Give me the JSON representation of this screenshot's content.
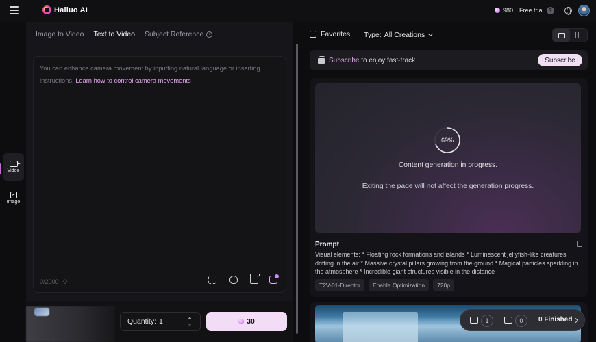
{
  "app": {
    "name": "Hailuo AI"
  },
  "header": {
    "credits": "980",
    "free_trial": "Free trial",
    "help_glyph": "?"
  },
  "rail": {
    "items": [
      {
        "label": "Video",
        "icon": "video-icon",
        "active": true
      },
      {
        "label": "Image",
        "icon": "image-icon",
        "active": false
      }
    ]
  },
  "left": {
    "tabs": [
      {
        "label": "Image to Video",
        "active": false
      },
      {
        "label": "Text to Video",
        "active": true
      },
      {
        "label": "Subject Reference",
        "active": false
      }
    ],
    "prompt_placeholder": "You can enhance camera movement by inputting natural language or inserting instructions.",
    "prompt_link": "Learn how to control camera movements",
    "char_count": "0/2000",
    "quantity_label": "Quantity:",
    "quantity_value": "1",
    "generate_cost": "30"
  },
  "right": {
    "favorites_label": "Favorites",
    "type_label": "Type:",
    "type_value": "All Creations",
    "banner": {
      "highlight": "Subscribe",
      "text": " to enjoy fast-track",
      "button": "Subscribe"
    },
    "generation": {
      "progress_pct": "69%",
      "progress_value": 0.69,
      "status": "Content generation in progress.",
      "note": "Exiting the page will not affect the generation progress."
    },
    "prompt_label": "Prompt",
    "prompt_body": "Visual elements: * Floating rock formations and islands * Luminescent jellyfish-like creatures drifting in the air * Massive crystal pillars growing from the ground * Magical particles sparkling in the atmosphere * Incredible giant structures visible in the distance",
    "chips": [
      "T2V-01-Director",
      "Enable Optimization",
      "720p"
    ],
    "tasks": {
      "video_count": "1",
      "image_count": "0",
      "finished_count": "0",
      "finished_label": "Finished"
    }
  },
  "colors": {
    "accent": "#e3a4ee",
    "button_bg": "#f3dcf6"
  }
}
